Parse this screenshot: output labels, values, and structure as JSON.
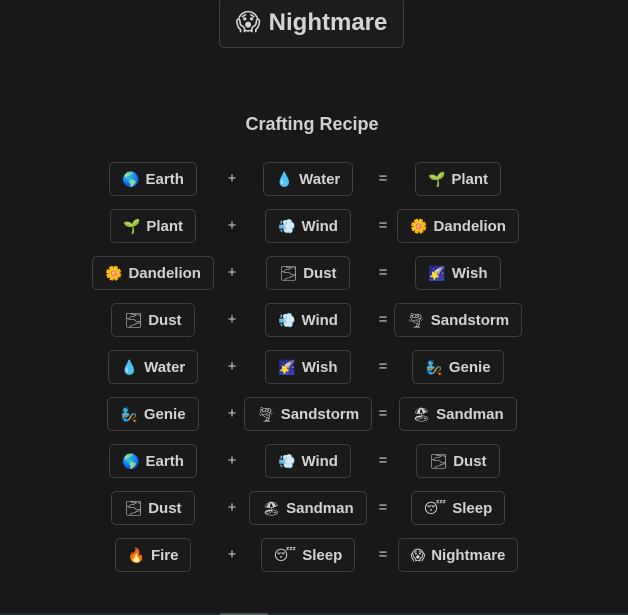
{
  "result": {
    "emoji": "😱",
    "label": "Nightmare"
  },
  "recipe_title": "Crafting Recipe",
  "operators": {
    "plus": "+",
    "equals": "="
  },
  "recipes": [
    {
      "a": {
        "emoji": "🌎",
        "label": "Earth"
      },
      "b": {
        "emoji": "💧",
        "label": "Water"
      },
      "c": {
        "emoji": "🌱",
        "label": "Plant"
      }
    },
    {
      "a": {
        "emoji": "🌱",
        "label": "Plant"
      },
      "b": {
        "emoji": "💨",
        "label": "Wind"
      },
      "c": {
        "emoji": "🌼",
        "label": "Dandelion"
      }
    },
    {
      "a": {
        "emoji": "🌼",
        "label": "Dandelion"
      },
      "b": {
        "emoji": "🌫",
        "label": "Dust"
      },
      "c": {
        "emoji": "🌠",
        "label": "Wish"
      }
    },
    {
      "a": {
        "emoji": "🌫",
        "label": "Dust"
      },
      "b": {
        "emoji": "💨",
        "label": "Wind"
      },
      "c": {
        "emoji": "🌪",
        "label": "Sandstorm"
      }
    },
    {
      "a": {
        "emoji": "💧",
        "label": "Water"
      },
      "b": {
        "emoji": "🌠",
        "label": "Wish"
      },
      "c": {
        "emoji": "🧞",
        "label": "Genie"
      }
    },
    {
      "a": {
        "emoji": "🧞",
        "label": "Genie"
      },
      "b": {
        "emoji": "🌪",
        "label": "Sandstorm"
      },
      "c": {
        "emoji": "🏖",
        "label": "Sandman"
      }
    },
    {
      "a": {
        "emoji": "🌎",
        "label": "Earth"
      },
      "b": {
        "emoji": "💨",
        "label": "Wind"
      },
      "c": {
        "emoji": "🌫",
        "label": "Dust"
      }
    },
    {
      "a": {
        "emoji": "🌫",
        "label": "Dust"
      },
      "b": {
        "emoji": "🏖",
        "label": "Sandman"
      },
      "c": {
        "emoji": "😴",
        "label": "Sleep"
      }
    },
    {
      "a": {
        "emoji": "🔥",
        "label": "Fire"
      },
      "b": {
        "emoji": "😴",
        "label": "Sleep"
      },
      "c": {
        "emoji": "😱",
        "label": "Nightmare"
      }
    }
  ]
}
